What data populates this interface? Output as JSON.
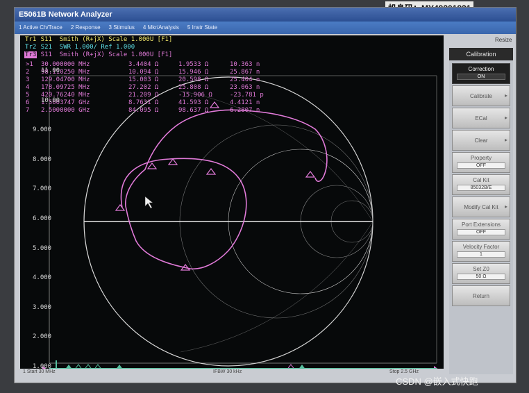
{
  "serial_label": "机身码：MY49201821",
  "window_title": "E5061B Network Analyzer",
  "menu": [
    "1 Active Ch/Trace",
    "2 Response",
    "3 Stimulus",
    "4 Mkr/Analysis",
    "5 Instr State"
  ],
  "resize_label": "Resize",
  "traces": [
    {
      "tag": "Tr1",
      "text": " S11  Smith (R+jX) Scale 1.000U [F1]"
    },
    {
      "tag": "Tr2",
      "text": " S21  SWR 1.000/ Ref 1.000"
    },
    {
      "tag": "Tr3",
      "text": " S11  Smith (R+jX) Scale 1.000U [F1]"
    }
  ],
  "markers": [
    {
      "id": ">1",
      "freq": "30.000000 MHz",
      "r": "3.4404 Ω",
      "x": "1.9533 Ω",
      "l": "10.363 n"
    },
    {
      "id": "2",
      "freq": "98.110250 MHz",
      "r": "10.094 Ω",
      "x": "15.946 Ω",
      "l": "25.867 n"
    },
    {
      "id": "3",
      "freq": "129.04700 MHz",
      "r": "15.003 Ω",
      "x": "20.598 Ω",
      "l": "25.404 n"
    },
    {
      "id": "4",
      "freq": "178.09725 MHz",
      "r": "27.202 Ω",
      "x": "25.808 Ω",
      "l": "23.063 n"
    },
    {
      "id": "5",
      "freq": "420.76240 MHz",
      "r": "21.209 Ω",
      "x": "-15.906 Ω",
      "l": "-23.781 p"
    },
    {
      "id": "6",
      "freq": "1.5003747 GHz",
      "r": "8.7631 Ω",
      "x": "41.593 Ω",
      "l": "4.4121 n"
    },
    {
      "id": "7",
      "freq": "2.5000000 GHz",
      "r": "84.095 Ω",
      "x": "98.637 Ω",
      "l": "6.2807 n"
    }
  ],
  "y_ticks": [
    "11.00",
    "10.00",
    "9.000",
    "8.000",
    "7.000",
    "6.000",
    "5.000",
    "4.000",
    "3.000",
    "2.000",
    "1.000"
  ],
  "status": {
    "start": "1  Start 30 MHz",
    "ifbw": "IFBW 30 kHz",
    "stop": "Stop 2.5 GHz"
  },
  "panel": {
    "title": "Calibration",
    "buttons": [
      {
        "label": "Correction",
        "value": "ON"
      },
      {
        "label": "Calibrate",
        "value": ""
      },
      {
        "label": "ECal",
        "value": ""
      },
      {
        "label": "Clear",
        "value": ""
      },
      {
        "label": "Property",
        "value": "OFF"
      },
      {
        "label": "Cal Kit",
        "value": "85032B/E"
      },
      {
        "label": "Modify Cal Kit",
        "value": ""
      },
      {
        "label": "Port Extensions",
        "value": "OFF"
      },
      {
        "label": "Velocity Factor",
        "value": "1"
      },
      {
        "label": "Set Z0",
        "value": "50 Ω"
      },
      {
        "label": "Return",
        "value": ""
      }
    ]
  },
  "watermark": "CSDN @嵌入式快跑",
  "colors": {
    "trace1": "#f2e86a",
    "trace2": "#5fe0e8",
    "trace3": "#e07ad8",
    "screen": "#07090a"
  }
}
